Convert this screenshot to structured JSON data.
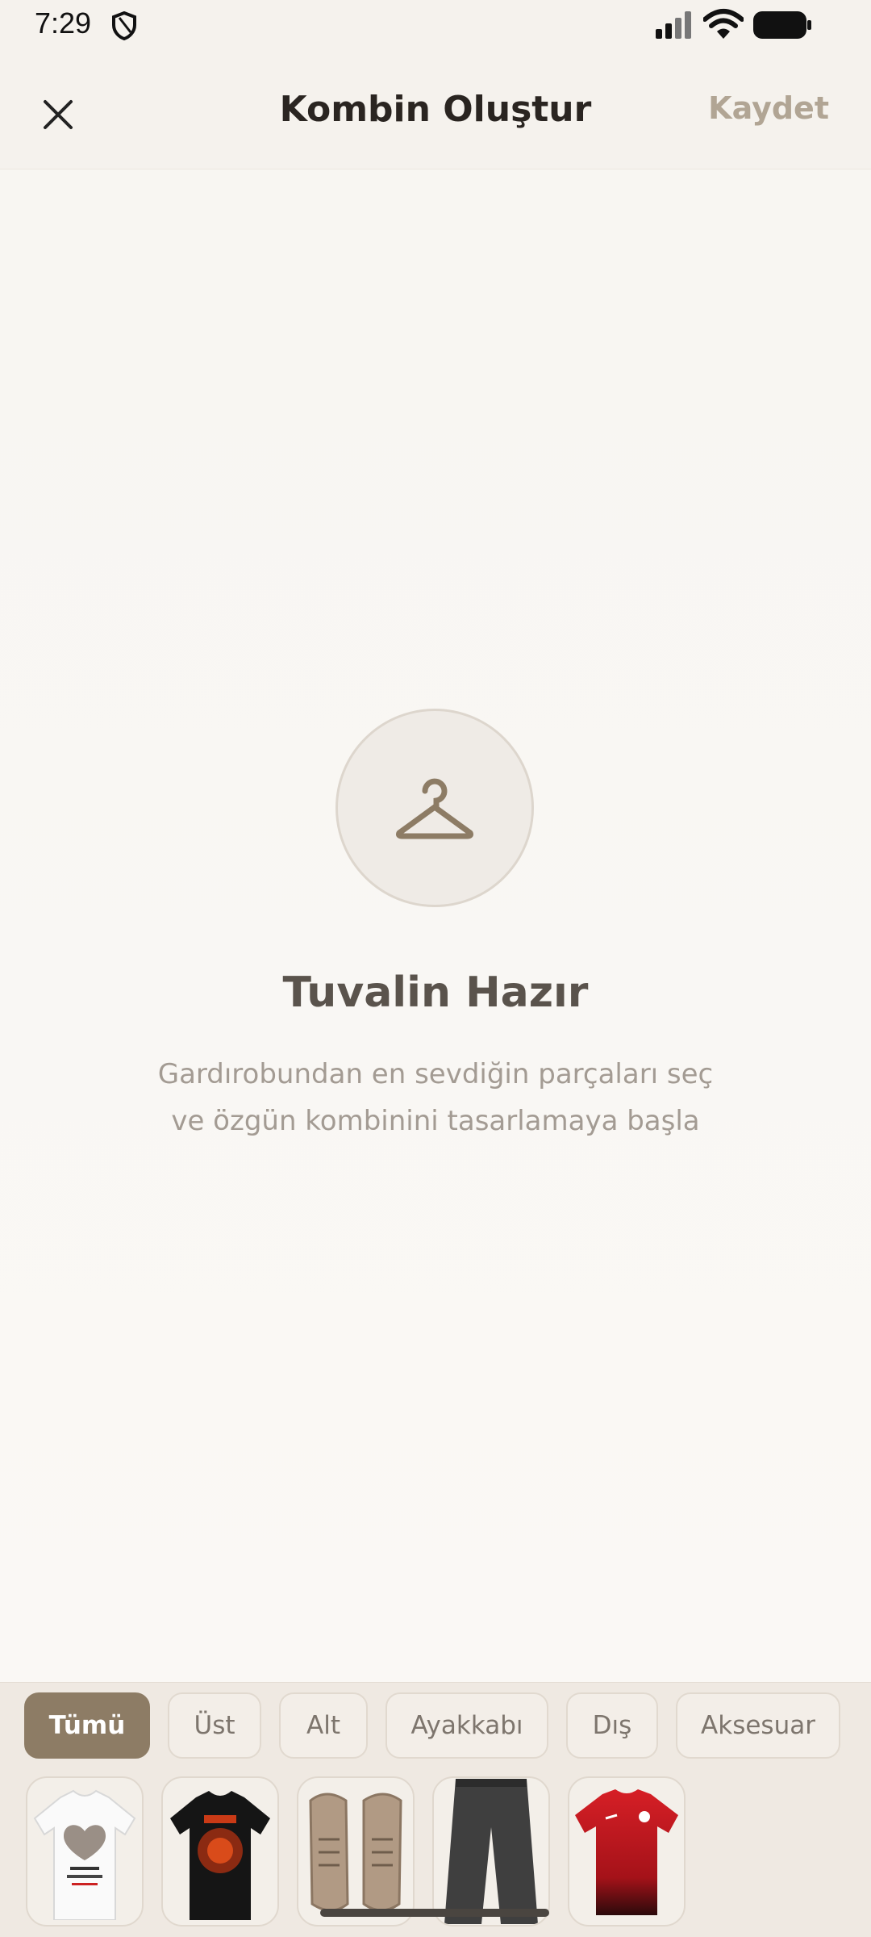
{
  "status_bar": {
    "time": "7:29",
    "icons": [
      "shield-icon",
      "signal-icon",
      "wifi-icon",
      "battery-icon"
    ]
  },
  "header": {
    "close_icon": "close-icon",
    "title": "Kombin Oluştur",
    "save_label": "Kaydet"
  },
  "canvas": {
    "icon": "hanger-icon",
    "empty_title": "Tuvalin Hazır",
    "empty_description_line1": "Gardırobundan en sevdiğin parçaları seç",
    "empty_description_line2": "ve özgün kombinini tasarlamaya başla"
  },
  "picker": {
    "categories": [
      {
        "label": "Tümü",
        "selected": true
      },
      {
        "label": "Üst",
        "selected": false
      },
      {
        "label": "Alt",
        "selected": false
      },
      {
        "label": "Ayakkabı",
        "selected": false
      },
      {
        "label": "Dış",
        "selected": false
      },
      {
        "label": "Aksesuar",
        "selected": false
      }
    ],
    "items": [
      {
        "name": "white-photo-tshirt",
        "icon": "white-tshirt-image"
      },
      {
        "name": "black-graphic-tshirt",
        "icon": "black-tshirt-image"
      },
      {
        "name": "beige-sneakers",
        "icon": "sneakers-image"
      },
      {
        "name": "grey-trousers",
        "icon": "trousers-image"
      },
      {
        "name": "red-football-jersey",
        "icon": "red-jersey-image"
      }
    ]
  },
  "colors": {
    "accent": "#8d7c65",
    "save_disabled": "#b1a594",
    "background": "#f8f6f2"
  }
}
